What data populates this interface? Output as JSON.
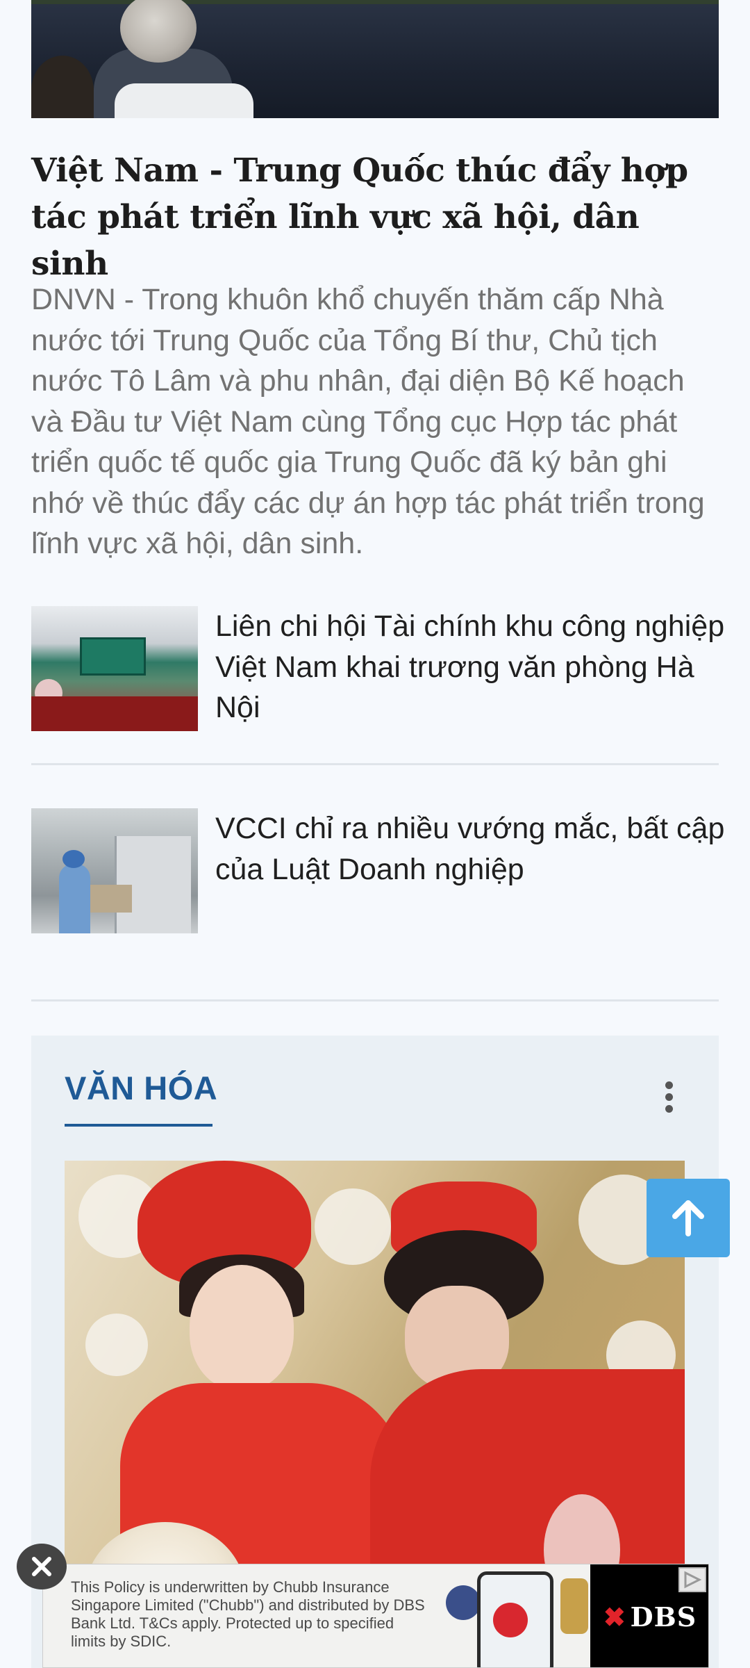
{
  "headline": "Việt Nam - Trung Quốc thúc đẩy hợp tác phát triển lĩnh vực xã hội, dân sinh",
  "summary": "DNVN - Trong khuôn khổ chuyến thăm cấp Nhà nước tới Trung Quốc của Tổng Bí thư, Chủ tịch nước Tô Lâm và phu nhân, đại diện Bộ Kế hoạch và Đầu tư Việt Nam cùng Tổng cục Hợp tác phát triển quốc tế quốc gia Trung Quốc đã ký bản ghi nhớ về thúc đẩy các dự án hợp tác phát triển trong lĩnh vực xã hội, dân sinh.",
  "related": [
    {
      "title": "Liên chi hội Tài chính khu công nghiệp Việt Nam khai trương văn phòng Hà Nội"
    },
    {
      "title": "VCCI chỉ ra nhiều vướng mắc, bất cập của Luật Doanh nghiệp"
    }
  ],
  "section": {
    "title": "VĂN HÓA"
  },
  "ad": {
    "text": "This Policy is underwritten by Chubb Insurance Singapore Limited (\"Chubb\") and distributed by DBS Bank Ltd. T&Cs apply. Protected up to specified limits by SDIC.",
    "brand": "DBS",
    "close_label": "X"
  },
  "colors": {
    "accent": "#1f5a96",
    "scroll_button": "#4aa7e6",
    "background": "#f6f9fd"
  }
}
